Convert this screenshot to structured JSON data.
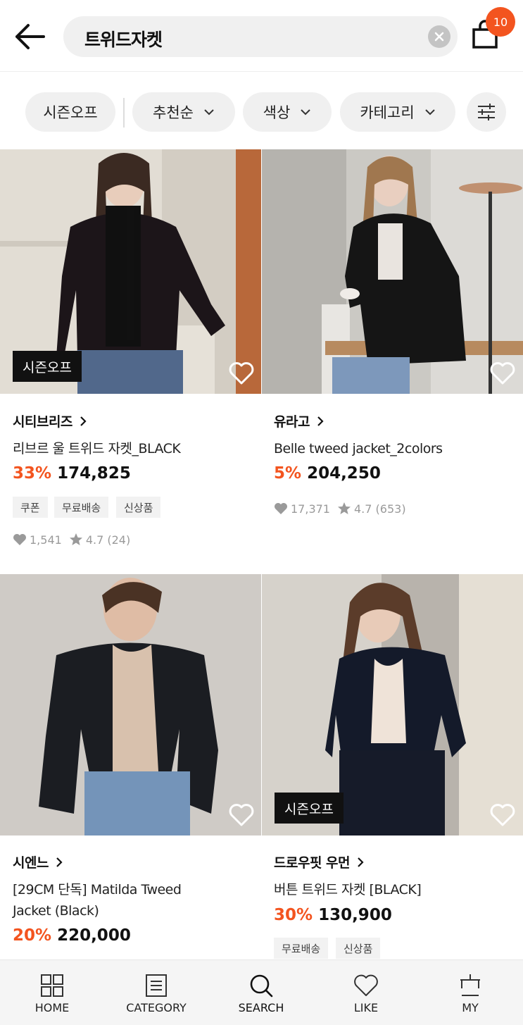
{
  "header": {
    "search_query": "트위드자켓",
    "cart_count": "10"
  },
  "filters": {
    "season_off": "시즌오프",
    "sort": "추천순",
    "color": "색상",
    "category": "카테고리"
  },
  "products": [
    {
      "badge": "시즌오프",
      "brand": "시티브리즈",
      "name": "리브르 울 트위드 자켓_BLACK",
      "discount": "33%",
      "price": "174,825",
      "tags": [
        "쿠폰",
        "무료배송",
        "신상품"
      ],
      "likes": "1,541",
      "rating": "4.7",
      "reviews": "(24)"
    },
    {
      "brand": "유라고",
      "name": "Belle tweed jacket_2colors",
      "discount": "5%",
      "price": "204,250",
      "tags": [],
      "likes": "17,371",
      "rating": "4.7",
      "reviews": "(653)"
    },
    {
      "brand": "시엔느",
      "name_line1": "[29CM 단독] Matilda Tweed",
      "name_line2": "Jacket (Black)",
      "discount": "20%",
      "price": "220,000",
      "tags": []
    },
    {
      "badge": "시즌오프",
      "brand": "드로우핏 우먼",
      "name": "버튼 트위드 자켓 [BLACK]",
      "discount": "30%",
      "price": "130,900",
      "tags": [
        "무료배송",
        "신상품"
      ]
    }
  ],
  "nav": {
    "home": "HOME",
    "category": "CATEGORY",
    "search": "SEARCH",
    "like": "LIKE",
    "my": "MY"
  },
  "colors": {
    "accent": "#f3541f",
    "chip_bg": "#f0f0f0"
  }
}
